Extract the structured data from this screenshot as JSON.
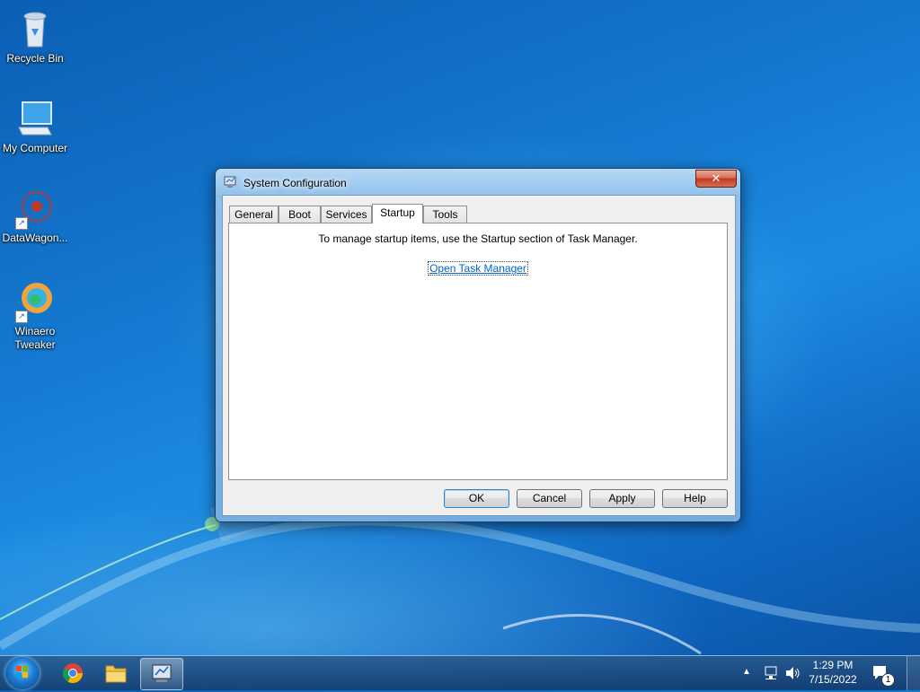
{
  "desktop": {
    "icons": [
      {
        "label": "Recycle Bin"
      },
      {
        "label": "My Computer"
      },
      {
        "label": "DataWagon..."
      },
      {
        "label": "Winaero Tweaker"
      }
    ]
  },
  "window": {
    "title": "System Configuration",
    "close_label": "x",
    "tabs": [
      "General",
      "Boot",
      "Services",
      "Startup",
      "Tools"
    ],
    "active_tab": "Startup",
    "startup_message": "To manage startup items, use the Startup section of Task Manager.",
    "link_label": "Open Task Manager",
    "buttons": {
      "ok": "OK",
      "cancel": "Cancel",
      "apply": "Apply",
      "help": "Help"
    }
  },
  "taskbar": {
    "time": "1:29 PM",
    "date": "7/15/2022",
    "notification_count": "1"
  }
}
